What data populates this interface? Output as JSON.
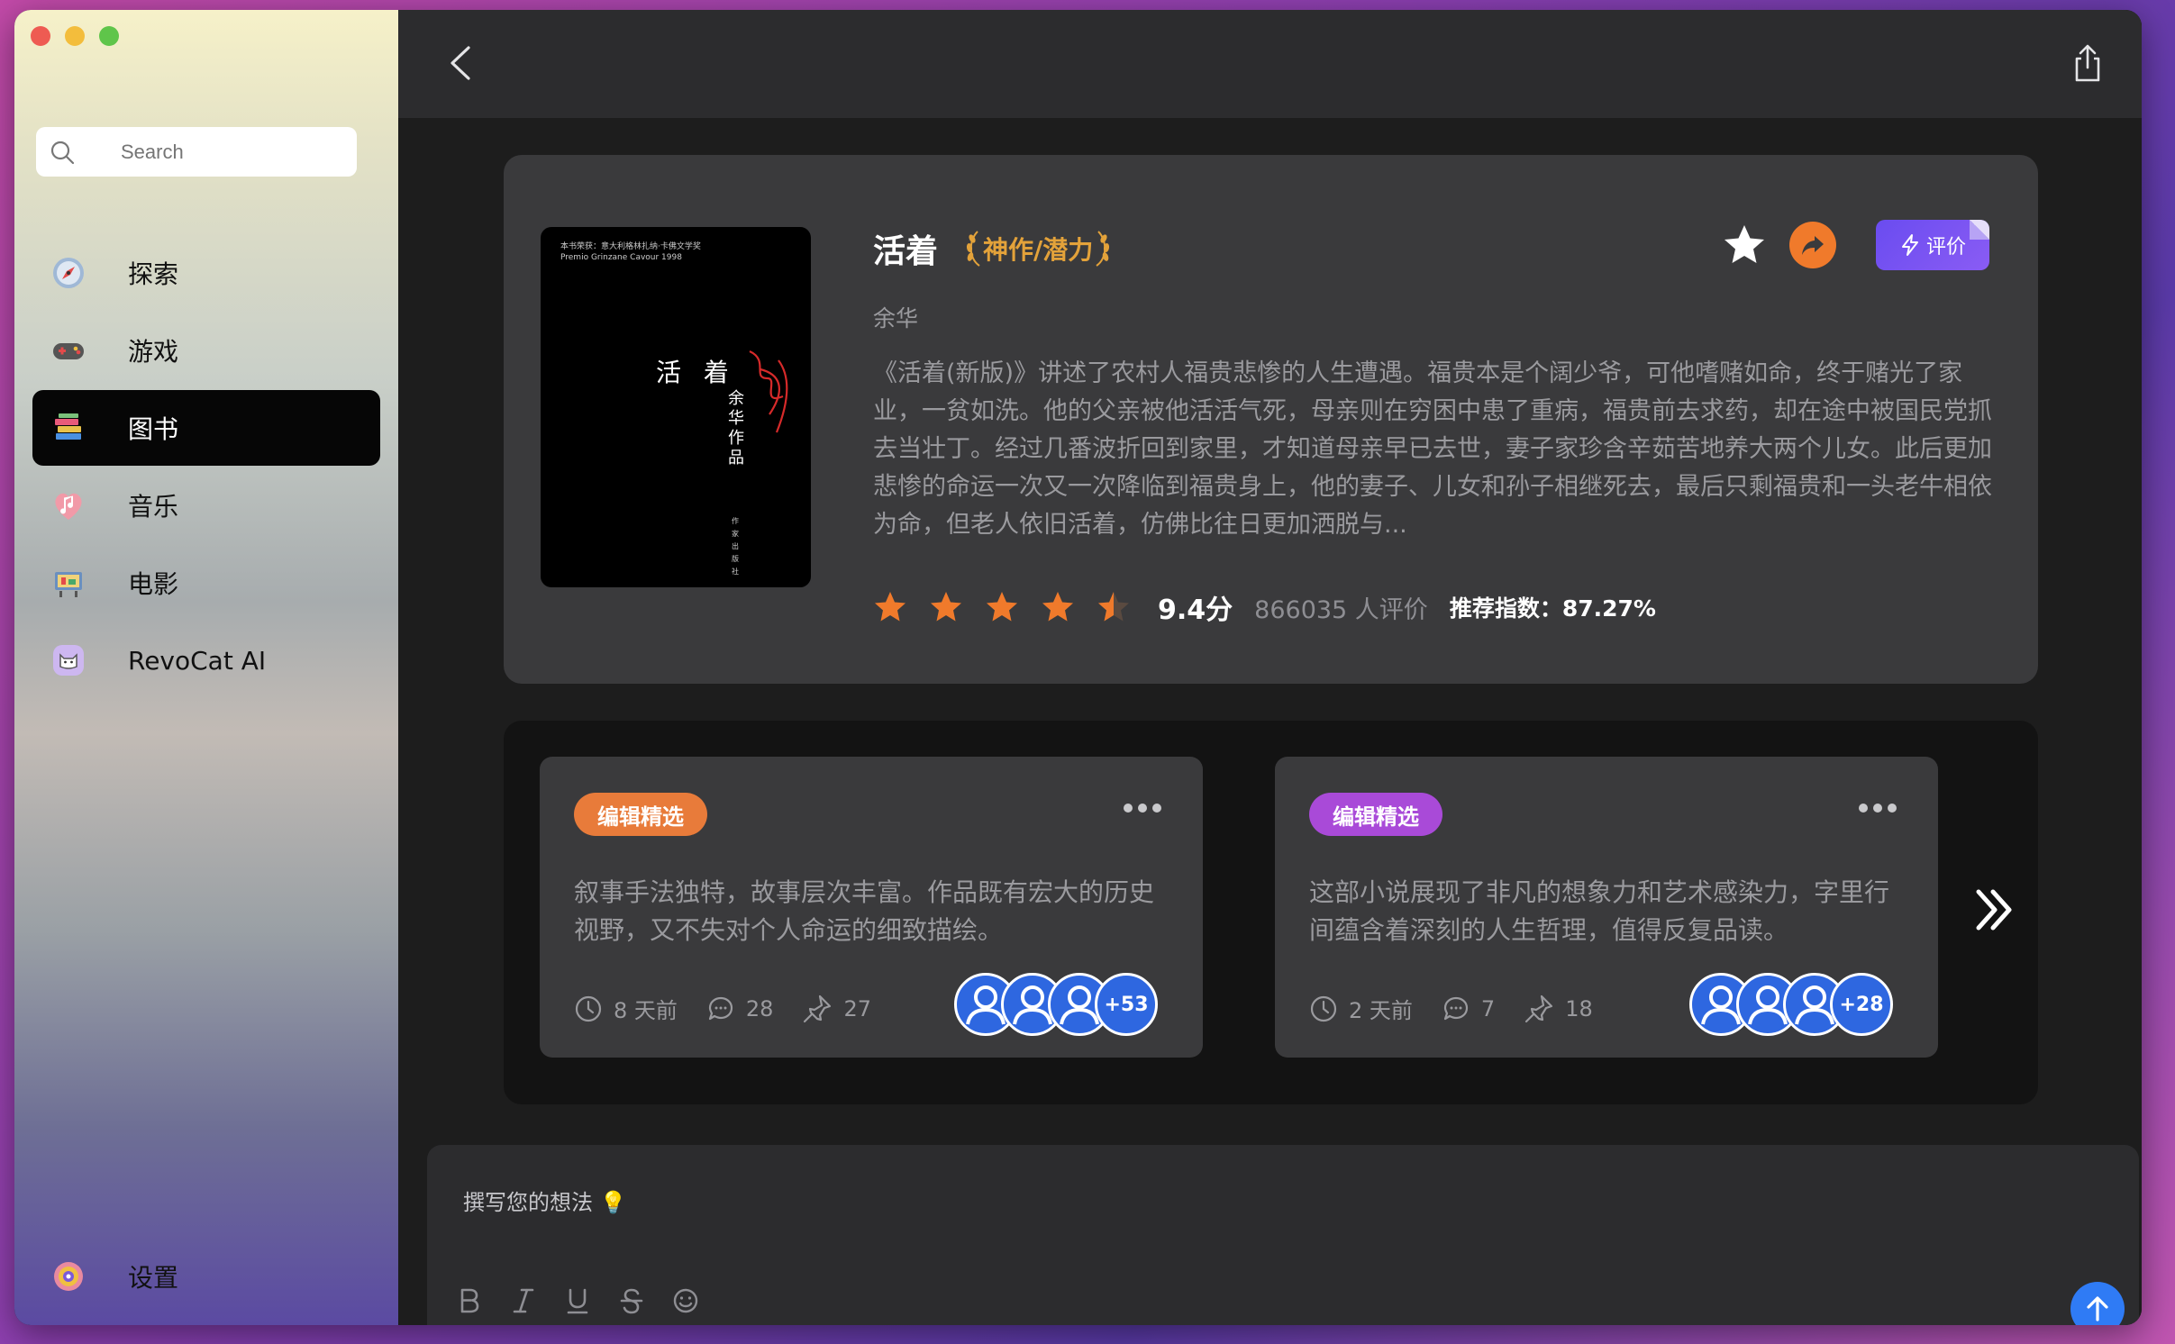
{
  "sidebar": {
    "search_placeholder": "Search",
    "items": [
      {
        "label": "探索",
        "icon": "compass-icon"
      },
      {
        "label": "游戏",
        "icon": "gamepad-icon"
      },
      {
        "label": "图书",
        "icon": "books-icon",
        "active": true
      },
      {
        "label": "音乐",
        "icon": "music-icon"
      },
      {
        "label": "电影",
        "icon": "movie-icon"
      },
      {
        "label": "RevoCat AI",
        "icon": "cat-icon"
      }
    ],
    "settings_label": "设置"
  },
  "book": {
    "title": "活着",
    "badge": "神作/潜力",
    "author": "余华",
    "description": "《活着(新版)》讲述了农村人福贵悲惨的人生遭遇。福贵本是个阔少爷，可他嗜赌如命，终于赌光了家业，一贫如洗。他的父亲被他活活气死，母亲则在穷困中患了重病，福贵前去求药，却在途中被国民党抓去当壮丁。经过几番波折回到家里，才知道母亲早已去世，妻子家珍含辛茹苦地养大两个儿女。此后更加悲惨的命运一次又一次降临到福贵身上，他的妻子、儿女和孙子相继死去，最后只剩福贵和一头老牛相依为命，但老人依旧活着，仿佛比往日更加洒脱与...",
    "score": "9.4分",
    "stars": 4.5,
    "reviews": "866035 人评价",
    "recommend": "推荐指数：87.27%",
    "rate_label": "评价",
    "cover": {
      "top_line1": "本书荣获：意大利格林扎纳·卡佛文学奖",
      "top_line2": "Premio Grinzane Cavour 1998",
      "title": "活 着",
      "author": "余华作品"
    }
  },
  "comments": [
    {
      "tag": "编辑精选",
      "tag_color": "#e87b3a",
      "text": "叙事手法独特，故事层次丰富。作品既有宏大的历史视野，又不失对个人命运的细致描绘。",
      "time": "8 天前",
      "replies": "28",
      "likes": "27",
      "more_count": "+53"
    },
    {
      "tag": "编辑精选",
      "tag_color": "#a94ad8",
      "text": "这部小说展现了非凡的想象力和艺术感染力，字里行间蕴含着深刻的人生哲理，值得反复品读。",
      "time": "2 天前",
      "replies": "7",
      "likes": "18",
      "more_count": "+28"
    }
  ],
  "editor": {
    "placeholder": "撰写您的想法 💡"
  },
  "colors": {
    "accent_orange": "#f07a2b",
    "accent_purple": "#6a4cf0",
    "send_blue": "#2f7bf5",
    "badge_gold": "#e3a23a"
  }
}
